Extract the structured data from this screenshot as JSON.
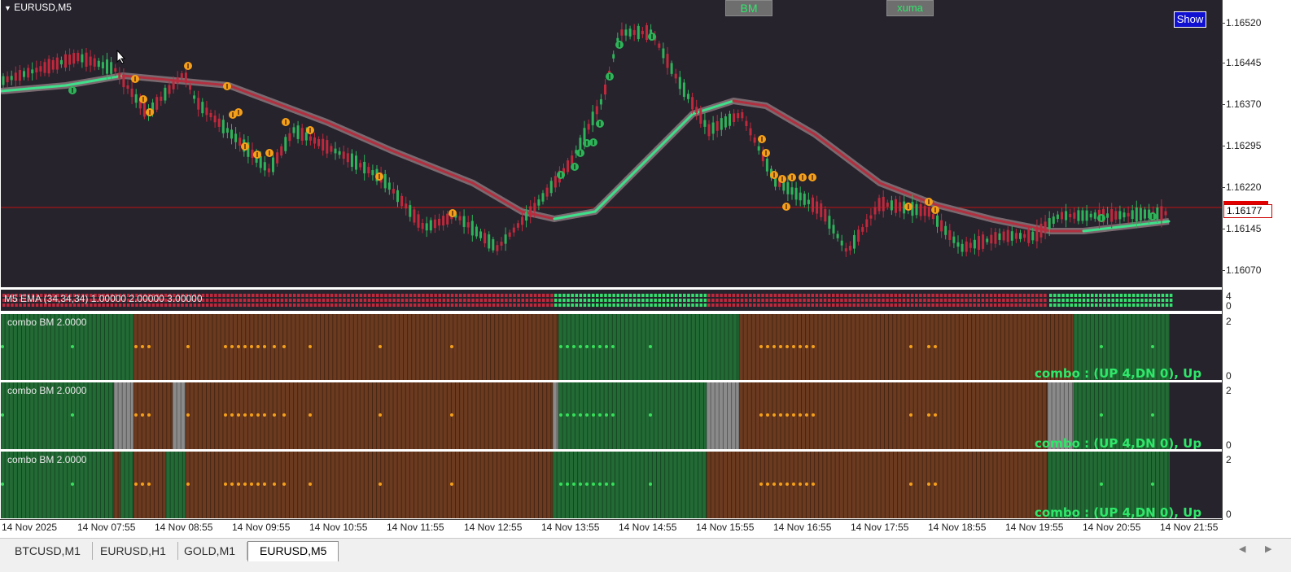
{
  "main": {
    "symbol_label": "EURUSD,M5",
    "buttons": {
      "bm": "BM",
      "xuma": "xuma",
      "show": "Show"
    },
    "price_axis": [
      "1.16520",
      "1.16445",
      "1.16370",
      "1.16295",
      "1.16220",
      "1.16145",
      "1.16070"
    ],
    "current_price": "1.16177"
  },
  "ema_pane": {
    "title": "M5 EMA (34,34,34) 1.00000 2.00000 3.00000",
    "axis": [
      "4",
      "0"
    ]
  },
  "combo_panes": [
    {
      "title": "combo BM  2.0000",
      "status": "combo : (UP 4,DN 0), Up",
      "axis": [
        "2",
        "0"
      ]
    },
    {
      "title": "combo BM  2.0000",
      "status": "combo : (UP 4,DN 0), Up",
      "axis": [
        "2",
        "0"
      ]
    },
    {
      "title": "combo BM  2.0000",
      "status": "combo : (UP 4,DN 0), Up",
      "axis": [
        "2",
        "0"
      ]
    }
  ],
  "time_axis": [
    "14 Nov 2025",
    "14 Nov 07:55",
    "14 Nov 08:55",
    "14 Nov 09:55",
    "14 Nov 10:55",
    "14 Nov 11:55",
    "14 Nov 12:55",
    "14 Nov 13:55",
    "14 Nov 14:55",
    "14 Nov 15:55",
    "14 Nov 16:55",
    "14 Nov 17:55",
    "14 Nov 18:55",
    "14 Nov 19:55",
    "14 Nov 20:55",
    "14 Nov 21:55"
  ],
  "tabs": [
    {
      "label": "BTCUSD,M1",
      "active": false
    },
    {
      "label": "EURUSD,H1",
      "active": false
    },
    {
      "label": "GOLD,M1",
      "active": false
    },
    {
      "label": "EURUSD,M5",
      "active": true
    }
  ],
  "colors": {
    "background": "#26232d",
    "bull_candle": "#2fb35a",
    "bear_candle": "#c0283c",
    "ma_up": "#3fe08a",
    "ma_down": "#b03040",
    "combo_green": "#226b35",
    "combo_brown": "#6b3a1f",
    "combo_gray": "#8a8a8a",
    "dot_green": "#36e05a",
    "dot_orange": "#f5a01a",
    "price_line": "#c01010"
  }
}
